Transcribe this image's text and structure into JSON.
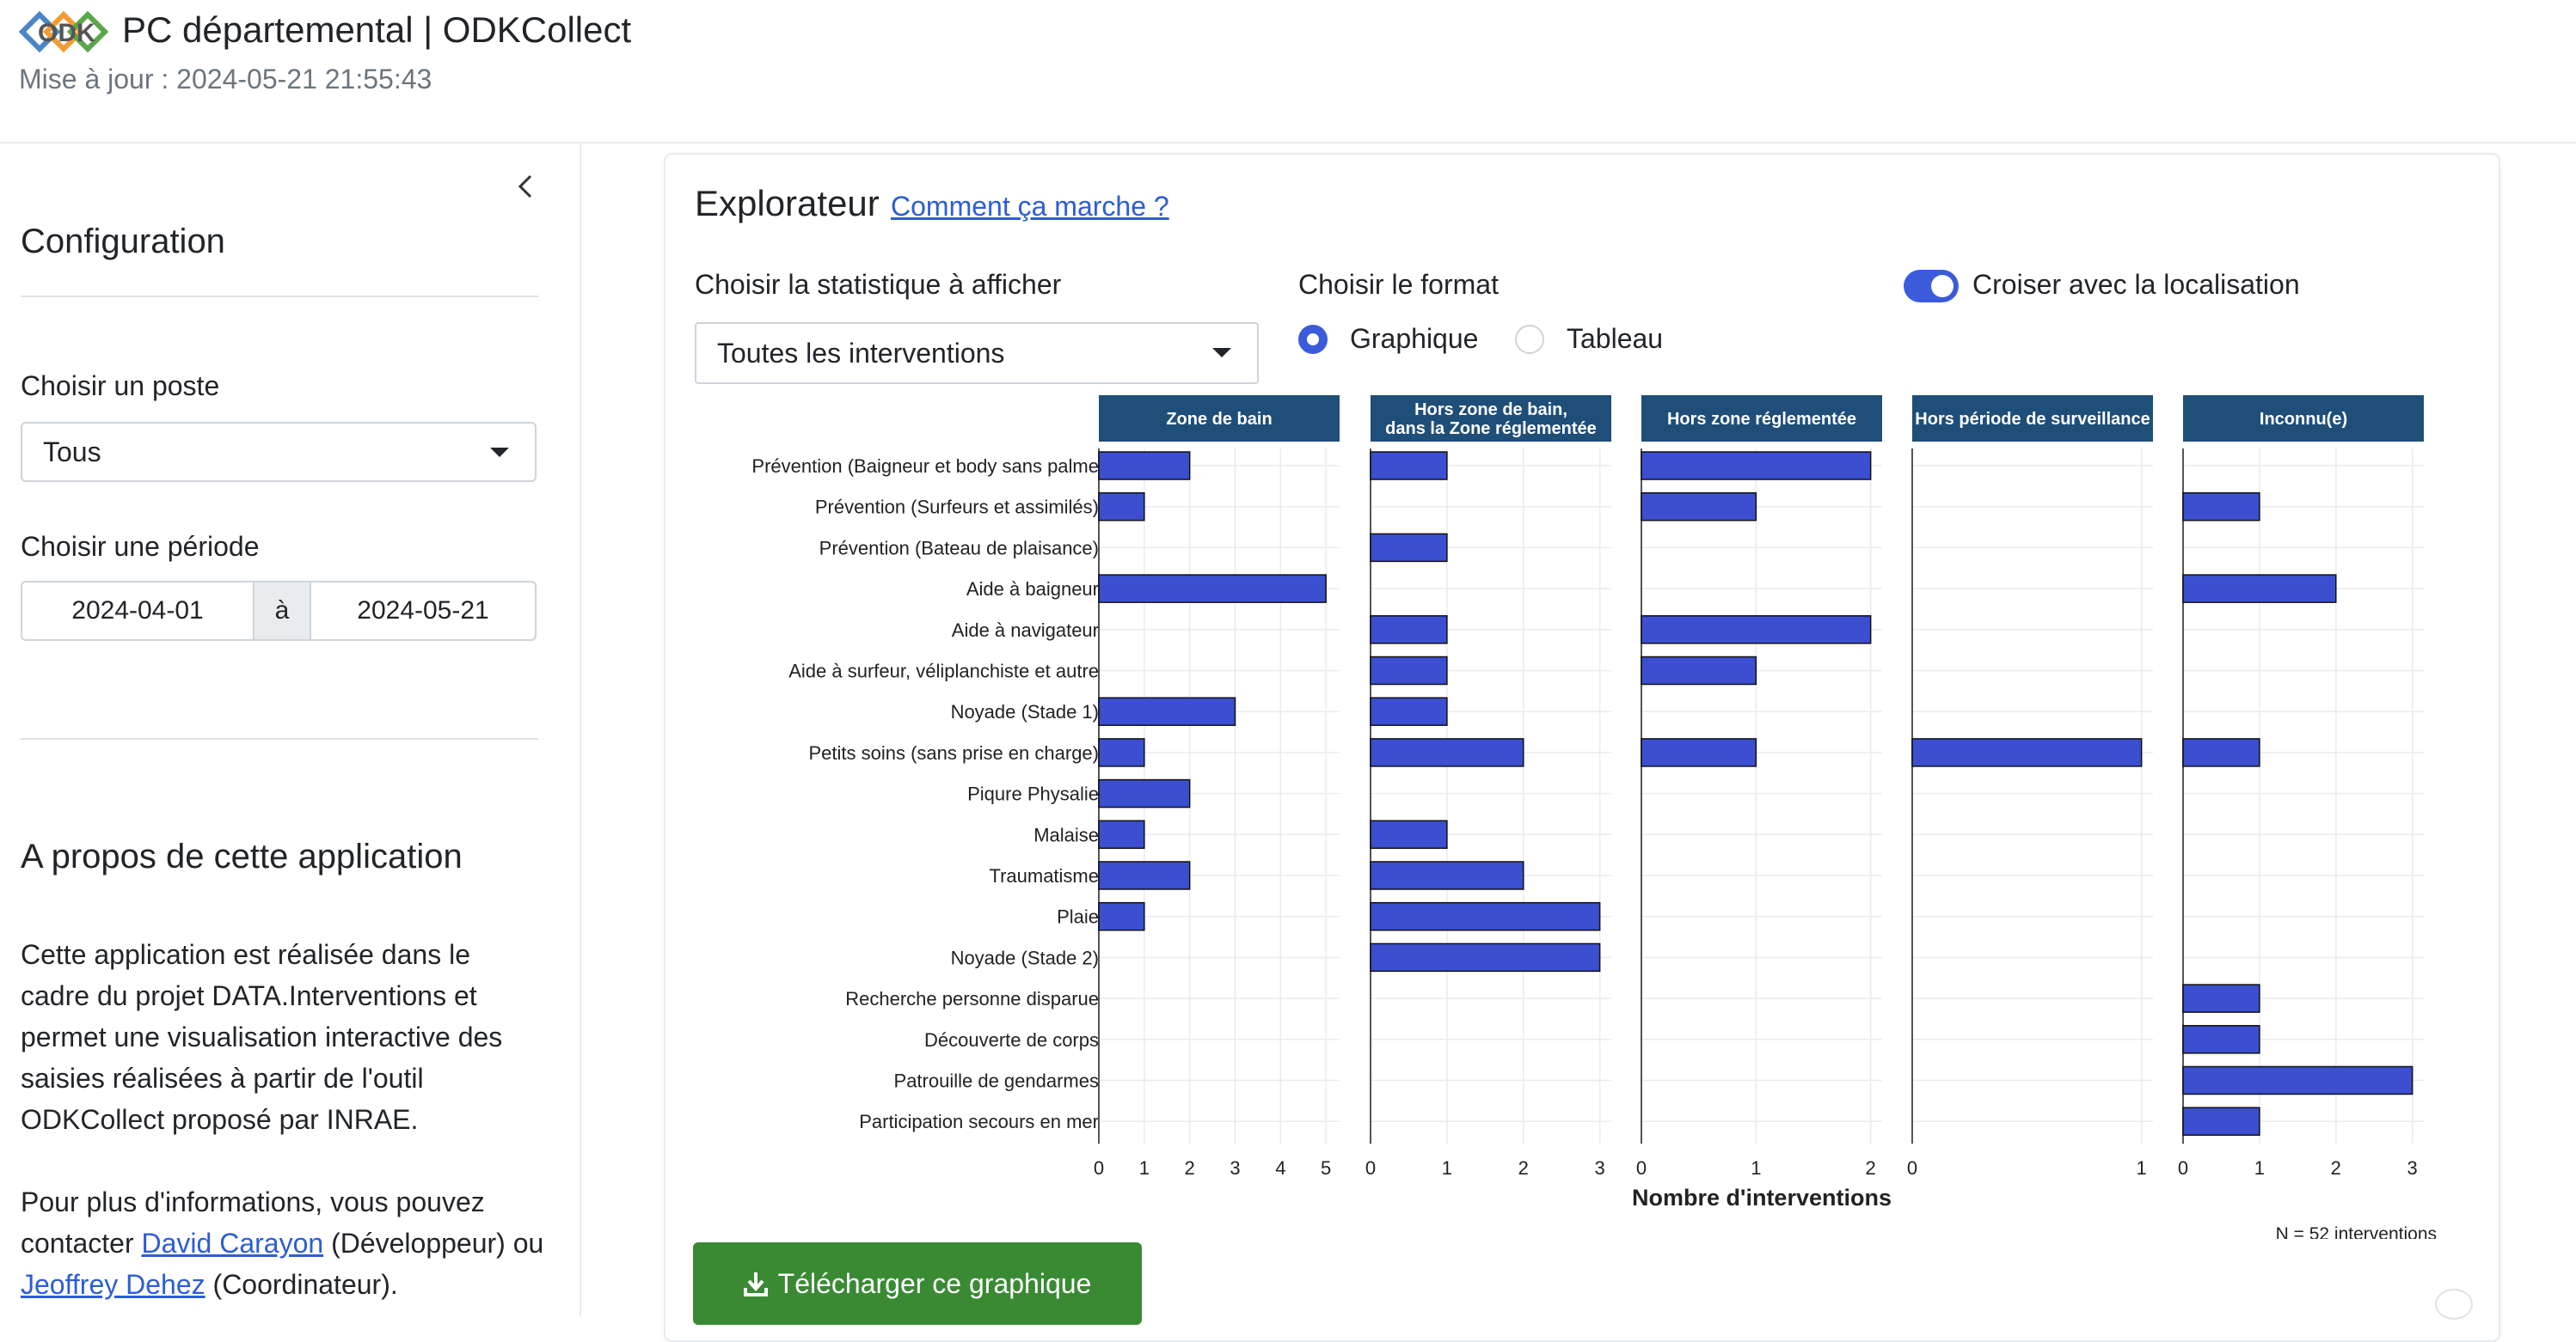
{
  "header": {
    "title": "PC départemental | ODKCollect",
    "updated": "Mise à jour : 2024-05-21 21:55:43"
  },
  "sidebar": {
    "config_title": "Configuration",
    "poste_label": "Choisir un poste",
    "poste_value": "Tous",
    "periode_label": "Choisir une période",
    "date_start": "2024-04-01",
    "date_sep": "à",
    "date_end": "2024-05-21",
    "about_title": "A propos de cette application",
    "about_text": "Cette application est réalisée dans le cadre du projet DATA.Interventions et permet une visualisation interactive des saisies réalisées à partir de l'outil ODKCollect proposé par INRAE.",
    "contact_pre": "Pour plus d'informations, vous pouvez contacter ",
    "contact_dev_name": "David Carayon",
    "contact_dev_role": " (Développeur) ou ",
    "contact_coord_name": "Jeoffrey Dehez",
    "contact_coord_role": " (Coordinateur)."
  },
  "main": {
    "title": "Explorateur",
    "help_link": "Comment ça marche ?",
    "stat_label": "Choisir la statistique à afficher",
    "stat_value": "Toutes les interventions",
    "format_label": "Choisir le format",
    "format_options": [
      "Graphique",
      "Tableau"
    ],
    "format_selected": "Graphique",
    "cross_label": "Croiser avec la localisation",
    "cross_enabled": true,
    "download_label": "Télécharger ce graphique"
  },
  "colors": {
    "accent": "#3b5bdb",
    "bar": "#3b4fd0",
    "strip": "#1f4e79",
    "download": "#3a8a34",
    "link": "#2c5dd6"
  },
  "chart_data": {
    "type": "bar",
    "orientation": "horizontal",
    "faceted_by": "localisation",
    "xlabel": "Nombre d'interventions",
    "note": "N = 52 interventions",
    "categories": [
      "Prévention (Baigneur et body sans palme",
      "Prévention (Surfeurs et assimilés)",
      "Prévention (Bateau de plaisance)",
      "Aide à baigneur",
      "Aide à navigateur",
      "Aide à surfeur, véliplanchiste et autre",
      "Noyade (Stade 1)",
      "Petits soins (sans prise en charge)",
      "Piqure Physalie",
      "Malaise",
      "Traumatisme",
      "Plaie",
      "Noyade (Stade 2)",
      "Recherche personne disparue",
      "Découverte de corps",
      "Patrouille de gendarmes",
      "Participation secours en mer"
    ],
    "series": [
      {
        "name": "Zone de bain",
        "xlim": [
          0,
          5.3
        ],
        "ticks": [
          0,
          1,
          2,
          3,
          4,
          5
        ],
        "values": [
          2,
          1,
          0,
          5,
          0,
          0,
          3,
          1,
          2,
          1,
          2,
          1,
          0,
          0,
          0,
          0,
          0
        ]
      },
      {
        "name": "Hors zone de bain,\ndans la Zone réglementée",
        "xlim": [
          0,
          3.15
        ],
        "ticks": [
          0,
          1,
          2,
          3
        ],
        "values": [
          1,
          0,
          1,
          0,
          1,
          1,
          1,
          2,
          0,
          1,
          2,
          3,
          3,
          0,
          0,
          0,
          0
        ]
      },
      {
        "name": "Hors zone réglementée",
        "xlim": [
          0,
          2.1
        ],
        "ticks": [
          0,
          1,
          2
        ],
        "values": [
          2,
          1,
          0,
          0,
          2,
          1,
          0,
          1,
          0,
          0,
          0,
          0,
          0,
          0,
          0,
          0,
          0
        ]
      },
      {
        "name": "Hors période de surveillance",
        "xlim": [
          0,
          1.05
        ],
        "ticks": [
          0,
          1
        ],
        "values": [
          0,
          0,
          0,
          0,
          0,
          0,
          0,
          1,
          0,
          0,
          0,
          0,
          0,
          0,
          0,
          0,
          0
        ]
      },
      {
        "name": "Inconnu(e)",
        "xlim": [
          0,
          3.15
        ],
        "ticks": [
          0,
          1,
          2,
          3
        ],
        "values": [
          0,
          1,
          0,
          2,
          0,
          0,
          0,
          1,
          0,
          0,
          0,
          0,
          0,
          1,
          1,
          3,
          1
        ]
      }
    ]
  }
}
